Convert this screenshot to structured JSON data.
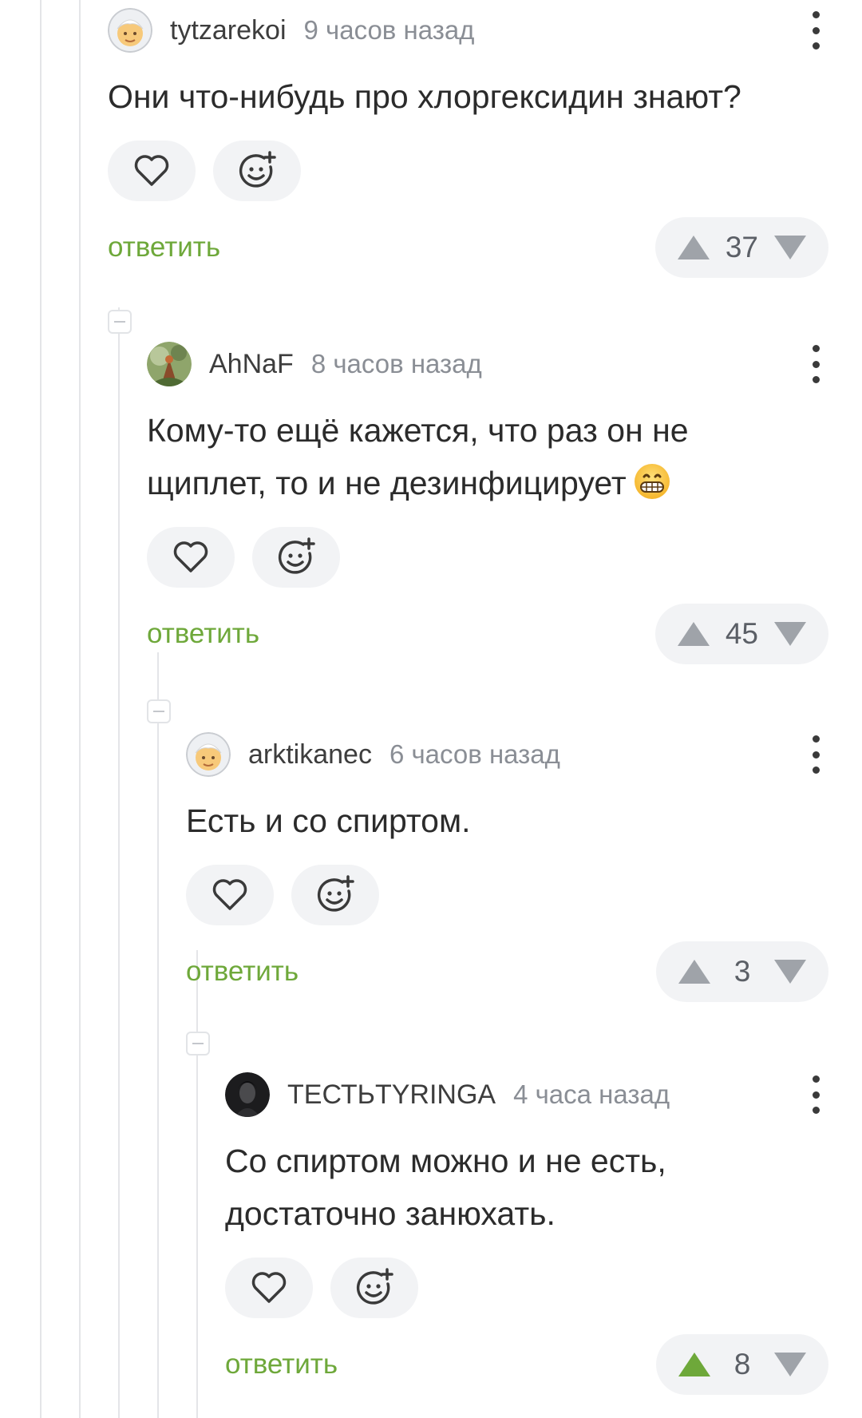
{
  "comments": [
    {
      "username": "tytzarekoi",
      "time": "9 часов назад",
      "lines": [
        "Они что-нибудь про хлоргексидин знают?"
      ],
      "reply_label": "ответить",
      "rating": "37",
      "avatar_icon": "cartoon-face-avatar"
    },
    {
      "username": "AhNaF",
      "time": "8 часов назад",
      "lines": [
        "Кому-то ещё кажется, что раз он не",
        "щиплет, то и не дезинфицирует"
      ],
      "emoji": "grinning-face-emoji",
      "reply_label": "ответить",
      "rating": "45",
      "avatar_icon": "nature-photo-avatar"
    },
    {
      "username": "arktikanec",
      "time": "6 часов назад",
      "lines": [
        "Есть и со спиртом."
      ],
      "reply_label": "ответить",
      "rating": "3",
      "avatar_icon": "cartoon-face-avatar"
    },
    {
      "username": "ТЕСТЬTYRINGA",
      "time": "4 часа назад",
      "lines": [
        "Со спиртом можно и не есть,",
        "достаточно занюхать."
      ],
      "reply_label": "ответить",
      "rating": "8",
      "upvoted": true,
      "avatar_icon": "dark-portrait-avatar"
    }
  ],
  "colors": {
    "accent_green": "#6ea83a",
    "upvote_active": "#6ea83a",
    "vote_inactive": "#9fa3a9",
    "pill_background": "#f2f3f5",
    "thread_line": "#e4e5e8"
  }
}
